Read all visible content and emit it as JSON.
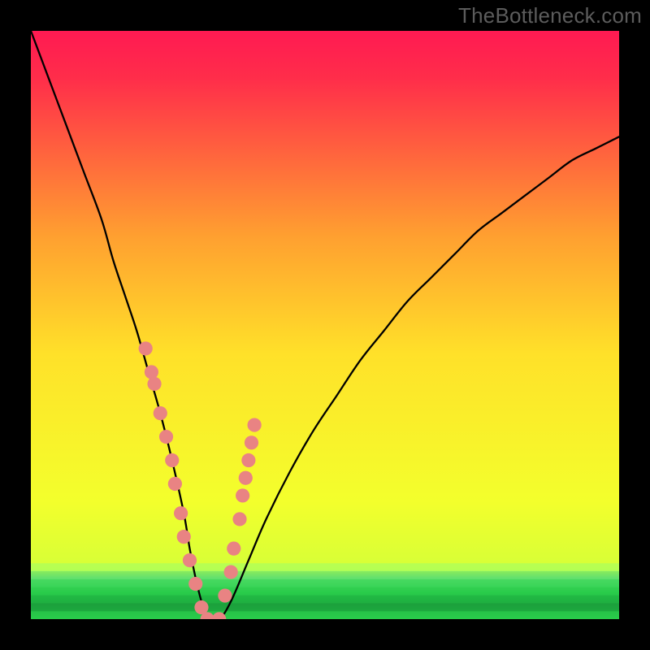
{
  "watermark": "TheBottleneck.com",
  "colors": {
    "frame": "#000000",
    "grad_top": "#ff1a52",
    "grad_mid": "#ffe129",
    "grad_low": "#e8ff29",
    "grad_green": "#29cc4b",
    "curve": "#000000",
    "marker_fill": "#e98383",
    "marker_stroke": "#d46a6a"
  },
  "chart_data": {
    "type": "line",
    "title": "",
    "xlabel": "",
    "ylabel": "",
    "xlim": [
      0,
      100
    ],
    "ylim": [
      0,
      100
    ],
    "series": [
      {
        "name": "bottleneck-curve",
        "x": [
          0,
          3,
          6,
          9,
          12,
          14,
          16,
          18,
          20,
          22,
          24,
          26,
          27,
          28,
          29,
          30,
          32,
          34,
          37,
          40,
          44,
          48,
          52,
          56,
          60,
          64,
          68,
          72,
          76,
          80,
          84,
          88,
          92,
          96,
          100
        ],
        "y": [
          100,
          92,
          84,
          76,
          68,
          61,
          55,
          49,
          42,
          35,
          27,
          18,
          12,
          7,
          3,
          0,
          0,
          3,
          10,
          17,
          25,
          32,
          38,
          44,
          49,
          54,
          58,
          62,
          66,
          69,
          72,
          75,
          78,
          80,
          82
        ]
      }
    ],
    "markers": {
      "name": "highlight-points",
      "x": [
        19.5,
        20.5,
        21,
        22,
        23,
        24,
        24.5,
        25.5,
        26,
        27,
        28,
        29,
        30,
        32,
        33,
        34,
        34.5,
        35.5,
        36,
        36.5,
        37,
        37.5,
        38
      ],
      "y": [
        46,
        42,
        40,
        35,
        31,
        27,
        23,
        18,
        14,
        10,
        6,
        2,
        0,
        0,
        4,
        8,
        12,
        17,
        21,
        24,
        27,
        30,
        33
      ]
    },
    "green_band_top_fraction": 0.905,
    "gradient_stops": [
      {
        "offset": 0.0,
        "color": "#ff1a52"
      },
      {
        "offset": 0.08,
        "color": "#ff2d4a"
      },
      {
        "offset": 0.35,
        "color": "#ffa030"
      },
      {
        "offset": 0.55,
        "color": "#ffe129"
      },
      {
        "offset": 0.8,
        "color": "#f3ff2c"
      },
      {
        "offset": 0.915,
        "color": "#d6ff37"
      },
      {
        "offset": 0.93,
        "color": "#62e06f"
      },
      {
        "offset": 0.955,
        "color": "#29cc4b"
      },
      {
        "offset": 0.975,
        "color": "#1ea33e"
      },
      {
        "offset": 1.0,
        "color": "#29cc4b"
      }
    ]
  }
}
